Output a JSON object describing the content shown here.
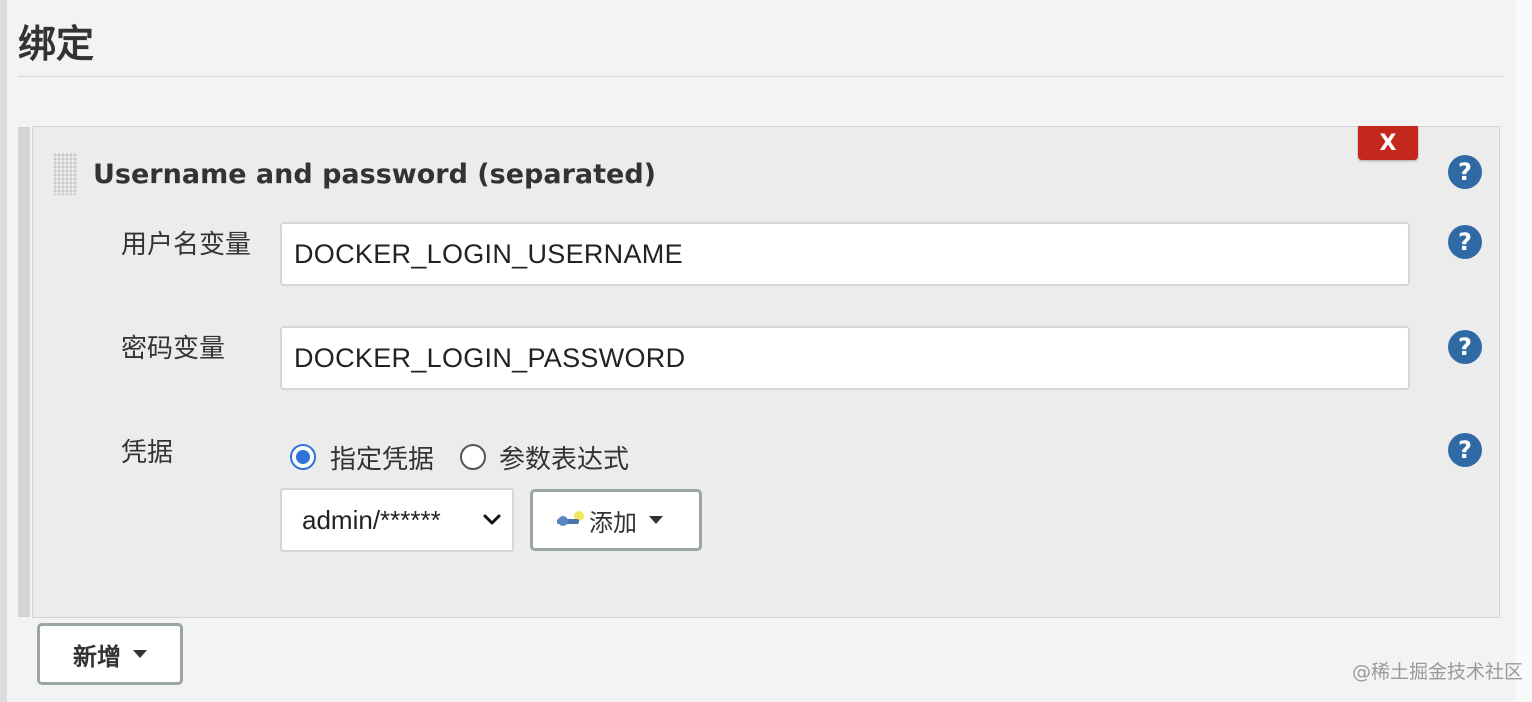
{
  "section": {
    "title": "绑定"
  },
  "binding": {
    "title": "Username and password (separated)",
    "delete_label": "X",
    "username_label": "用户名变量",
    "username_value": "DOCKER_LOGIN_USERNAME",
    "password_label": "密码变量",
    "password_value": "DOCKER_LOGIN_PASSWORD",
    "credentials_label": "凭据",
    "radio_options": [
      {
        "label": "指定凭据",
        "checked": true
      },
      {
        "label": "参数表达式",
        "checked": false
      }
    ],
    "credential_selected": "admin/******",
    "add_button_label": "添加",
    "help_label": "?"
  },
  "footer": {
    "new_button_label": "新增",
    "watermark": "@稀土掘金技术社区"
  },
  "colors": {
    "help_icon": "#2f6aa5",
    "delete_button": "#c4271b",
    "radio_accent": "#2f73d9"
  },
  "icons": [
    "drag-handle-icon",
    "help-icon",
    "key-icon",
    "chevron-down-icon",
    "caret-down-icon"
  ]
}
